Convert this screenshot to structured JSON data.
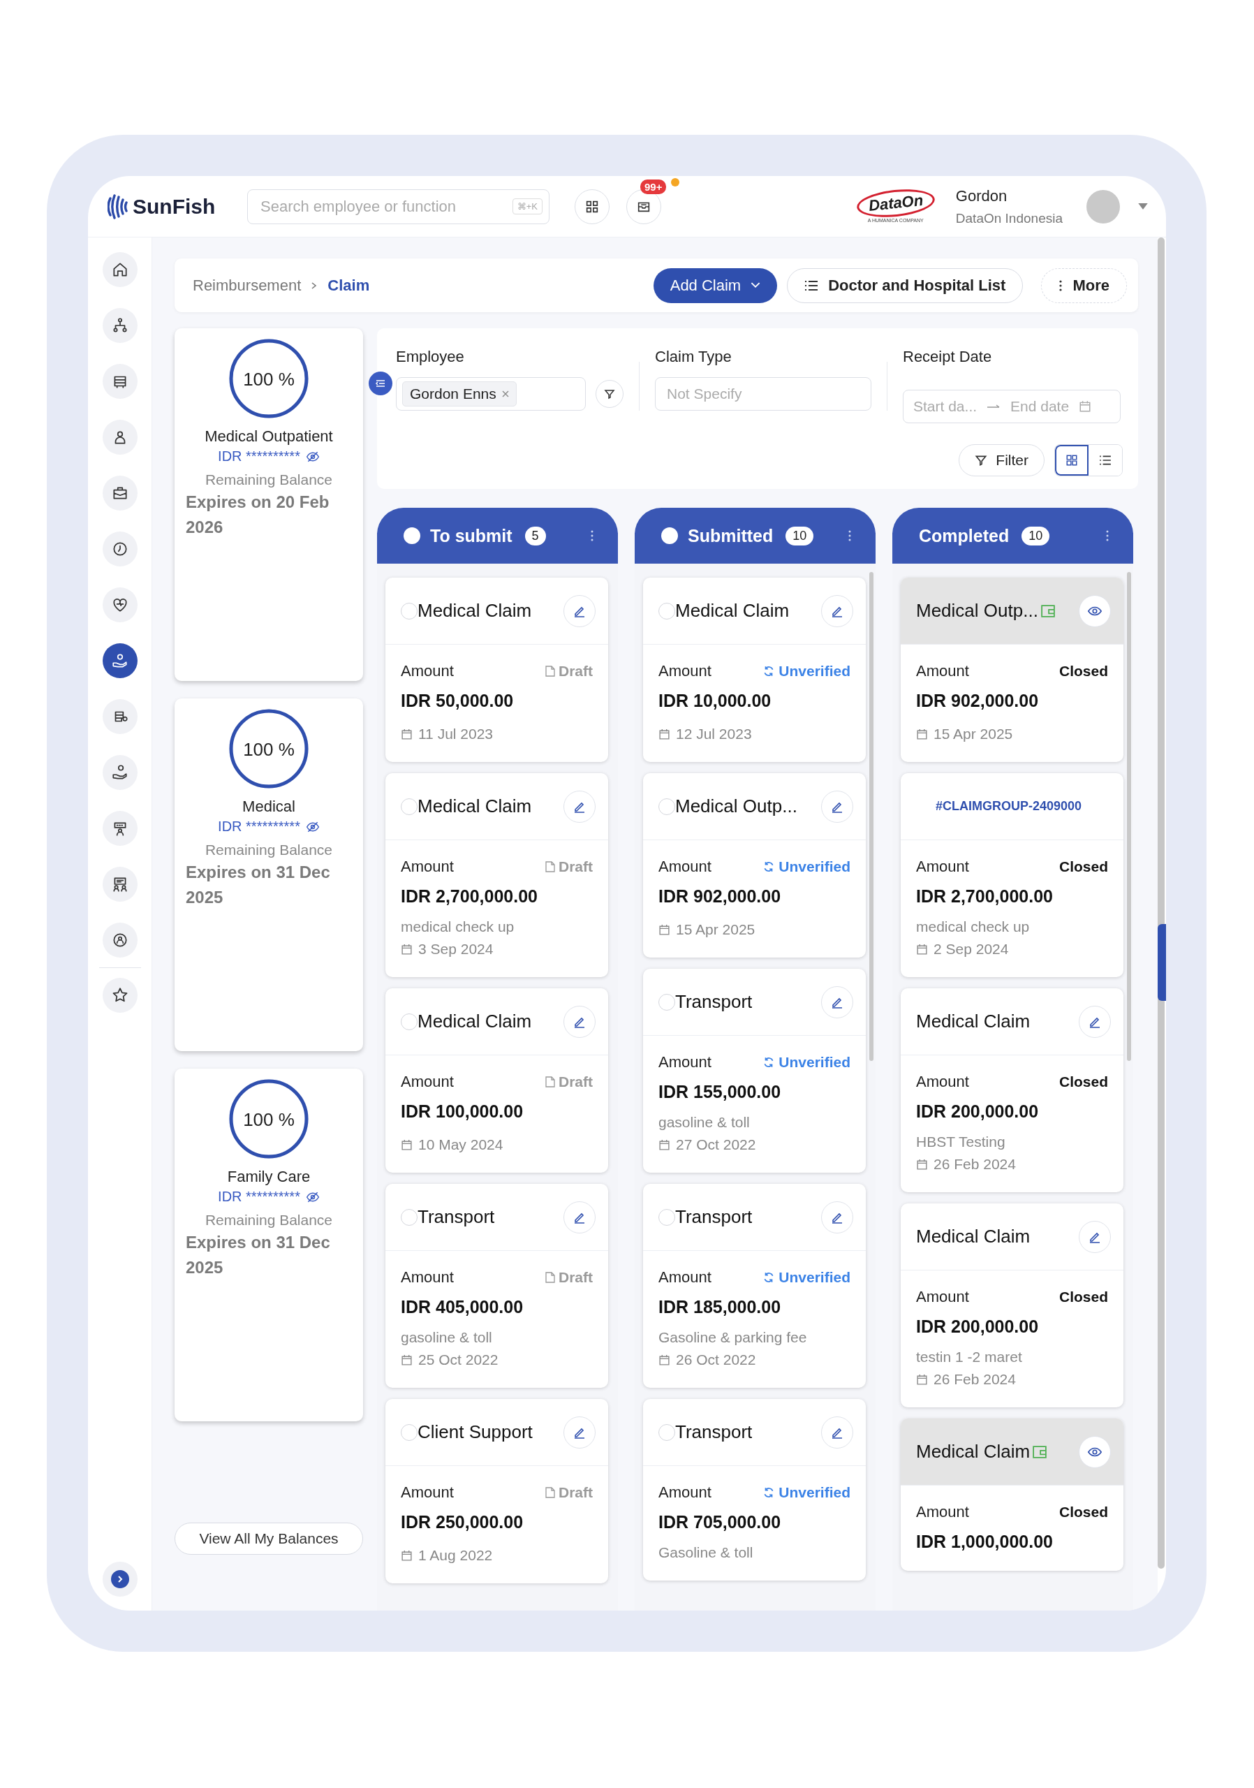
{
  "header": {
    "logo": "SunFish",
    "search": {
      "placeholder": "Search employee or function",
      "shortcut": "⌘+K"
    },
    "inbox": {
      "badge": "99+",
      "alert": true
    },
    "company": {
      "name": "DataOn",
      "tagline": "A HUMANICA COMPANY"
    },
    "user": {
      "name": "Gordon",
      "company": "DataOn Indonesia"
    }
  },
  "sidebar": {
    "items": [
      {
        "selected": false
      },
      {
        "selected": false
      },
      {
        "selected": false
      },
      {
        "selected": false
      },
      {
        "selected": false
      },
      {
        "selected": false
      },
      {
        "selected": false
      },
      {
        "selected": true
      },
      {
        "selected": false
      },
      {
        "selected": false
      },
      {
        "selected": false
      },
      {
        "selected": false
      },
      {
        "selected": false
      },
      {
        "selected": false
      }
    ]
  },
  "breadcrumb": [
    "Reimbursement",
    "Claim"
  ],
  "actions": [
    {
      "label": "Add Claim",
      "kind": "primary"
    },
    {
      "label": "Doctor and Hospital List",
      "kind": "list"
    },
    {
      "label": "More",
      "kind": "more"
    }
  ],
  "balances": {
    "cards": [
      {
        "percent": "100 %",
        "level": 1,
        "name": "Medical Outpatient",
        "amount": "IDR **********",
        "caption": "Remaining Balance",
        "expiry": "Expires on 20 Feb 2026"
      },
      {
        "percent": "100 %",
        "level": 1,
        "name": "Medical",
        "amount": "IDR **********",
        "caption": "Remaining Balance",
        "expiry": "Expires on 31 Dec 2025"
      },
      {
        "percent": "100 %",
        "level": 1,
        "name": "Family Care",
        "amount": "IDR **********",
        "caption": "Remaining Balance",
        "expiry": "Expires on 31 Dec 2025"
      }
    ],
    "button": "View All My Balances"
  },
  "filters": {
    "employee": {
      "label": "Employee",
      "chip": "Gordon Enns"
    },
    "claim_type": {
      "label": "Claim Type",
      "placeholder": "Not Specify"
    },
    "receipt_date": {
      "label": "Receipt Date",
      "start_placeholder": "Start da...",
      "end_placeholder": "End date"
    },
    "filter_button": "Filter",
    "views": [
      {
        "kind": "grid",
        "selected": true
      },
      {
        "kind": "list",
        "selected": false
      }
    ]
  },
  "board": {
    "columns": [
      {
        "title": "To submit",
        "count": "5",
        "selectable": true,
        "checked": false,
        "cards": [
          {
            "kind": "claim",
            "title": "Medical Claim",
            "checked": false,
            "action": {
              "kind": "edit"
            },
            "attachment": false,
            "highlighted": false,
            "amount_label": "Amount",
            "status": {
              "kind": "draft",
              "label": "Draft"
            },
            "amount": "IDR 50,000.00",
            "date": "11 Jul 2023"
          },
          {
            "kind": "claim",
            "title": "Medical Claim",
            "checked": false,
            "action": {
              "kind": "edit"
            },
            "attachment": false,
            "highlighted": false,
            "amount_label": "Amount",
            "status": {
              "kind": "draft",
              "label": "Draft"
            },
            "amount": "IDR 2,700,000.00",
            "note": "medical check up",
            "date": "3 Sep 2024"
          },
          {
            "kind": "claim",
            "title": "Medical Claim",
            "checked": false,
            "action": {
              "kind": "edit"
            },
            "attachment": false,
            "highlighted": false,
            "amount_label": "Amount",
            "status": {
              "kind": "draft",
              "label": "Draft"
            },
            "amount": "IDR 100,000.00",
            "date": "10 May 2024"
          },
          {
            "kind": "claim",
            "title": "Transport",
            "checked": false,
            "action": {
              "kind": "edit"
            },
            "attachment": false,
            "highlighted": false,
            "amount_label": "Amount",
            "status": {
              "kind": "draft",
              "label": "Draft"
            },
            "amount": "IDR 405,000.00",
            "note": "gasoline & toll",
            "date": "25 Oct 2022"
          },
          {
            "kind": "claim",
            "title": "Client Support",
            "checked": false,
            "action": {
              "kind": "edit"
            },
            "attachment": false,
            "highlighted": false,
            "amount_label": "Amount",
            "status": {
              "kind": "draft",
              "label": "Draft"
            },
            "amount": "IDR 250,000.00",
            "date": "1 Aug 2022"
          }
        ]
      },
      {
        "title": "Submitted",
        "count": "10",
        "selectable": true,
        "checked": false,
        "cards": [
          {
            "kind": "claim",
            "title": "Medical Claim",
            "checked": false,
            "action": {
              "kind": "edit"
            },
            "attachment": false,
            "highlighted": false,
            "amount_label": "Amount",
            "status": {
              "kind": "unverified",
              "label": "Unverified"
            },
            "amount": "IDR 10,000.00",
            "date": "12 Jul 2023"
          },
          {
            "kind": "claim",
            "title": "Medical Outp...",
            "checked": false,
            "action": {
              "kind": "edit"
            },
            "attachment": false,
            "highlighted": false,
            "amount_label": "Amount",
            "status": {
              "kind": "unverified",
              "label": "Unverified"
            },
            "amount": "IDR 902,000.00",
            "date": "15 Apr 2025"
          },
          {
            "kind": "claim",
            "title": "Transport",
            "checked": false,
            "action": {
              "kind": "edit"
            },
            "attachment": false,
            "highlighted": false,
            "amount_label": "Amount",
            "status": {
              "kind": "unverified",
              "label": "Unverified"
            },
            "amount": "IDR 155,000.00",
            "note": "gasoline & toll",
            "date": "27 Oct 2022"
          },
          {
            "kind": "claim",
            "title": "Transport",
            "checked": false,
            "action": {
              "kind": "edit"
            },
            "attachment": false,
            "highlighted": false,
            "amount_label": "Amount",
            "status": {
              "kind": "unverified",
              "label": "Unverified"
            },
            "amount": "IDR 185,000.00",
            "note": "Gasoline & parking fee",
            "date": "26 Oct 2022"
          },
          {
            "kind": "claim",
            "title": "Transport",
            "checked": false,
            "action": {
              "kind": "edit"
            },
            "attachment": false,
            "highlighted": false,
            "amount_label": "Amount",
            "status": {
              "kind": "unverified",
              "label": "Unverified"
            },
            "amount": "IDR 705,000.00",
            "note": "Gasoline & toll"
          }
        ]
      },
      {
        "title": "Completed",
        "count": "10",
        "selectable": false,
        "cards": [
          {
            "kind": "claim",
            "title": "Medical Outp...",
            "action": {
              "kind": "view"
            },
            "attachment": true,
            "highlighted": true,
            "amount_label": "Amount",
            "status": {
              "kind": "closed",
              "label": "Closed"
            },
            "amount": "IDR 902,000.00",
            "date": "15 Apr 2025"
          },
          {
            "kind": "group",
            "title": "#CLAIMGROUP-2409000",
            "attachment": false,
            "highlighted": false,
            "amount_label": "Amount",
            "status": {
              "kind": "closed",
              "label": "Closed"
            },
            "amount": "IDR 2,700,000.00",
            "note": "medical check up",
            "date": "2 Sep 2024"
          },
          {
            "kind": "claim",
            "title": "Medical Claim",
            "action": {
              "kind": "edit"
            },
            "attachment": false,
            "highlighted": false,
            "amount_label": "Amount",
            "status": {
              "kind": "closed",
              "label": "Closed"
            },
            "amount": "IDR 200,000.00",
            "note": "HBST Testing",
            "date": "26 Feb 2024"
          },
          {
            "kind": "claim",
            "title": "Medical Claim",
            "action": {
              "kind": "edit"
            },
            "attachment": false,
            "highlighted": false,
            "amount_label": "Amount",
            "status": {
              "kind": "closed",
              "label": "Closed"
            },
            "amount": "IDR 200,000.00",
            "note": "testin 1 -2 maret",
            "date": "26 Feb 2024"
          },
          {
            "kind": "claim",
            "title": "Medical Claim",
            "action": {
              "kind": "view"
            },
            "attachment": true,
            "highlighted": true,
            "amount_label": "Amount",
            "status": {
              "kind": "closed",
              "label": "Closed"
            },
            "amount": "IDR 1,000,000.00"
          }
        ]
      }
    ]
  }
}
